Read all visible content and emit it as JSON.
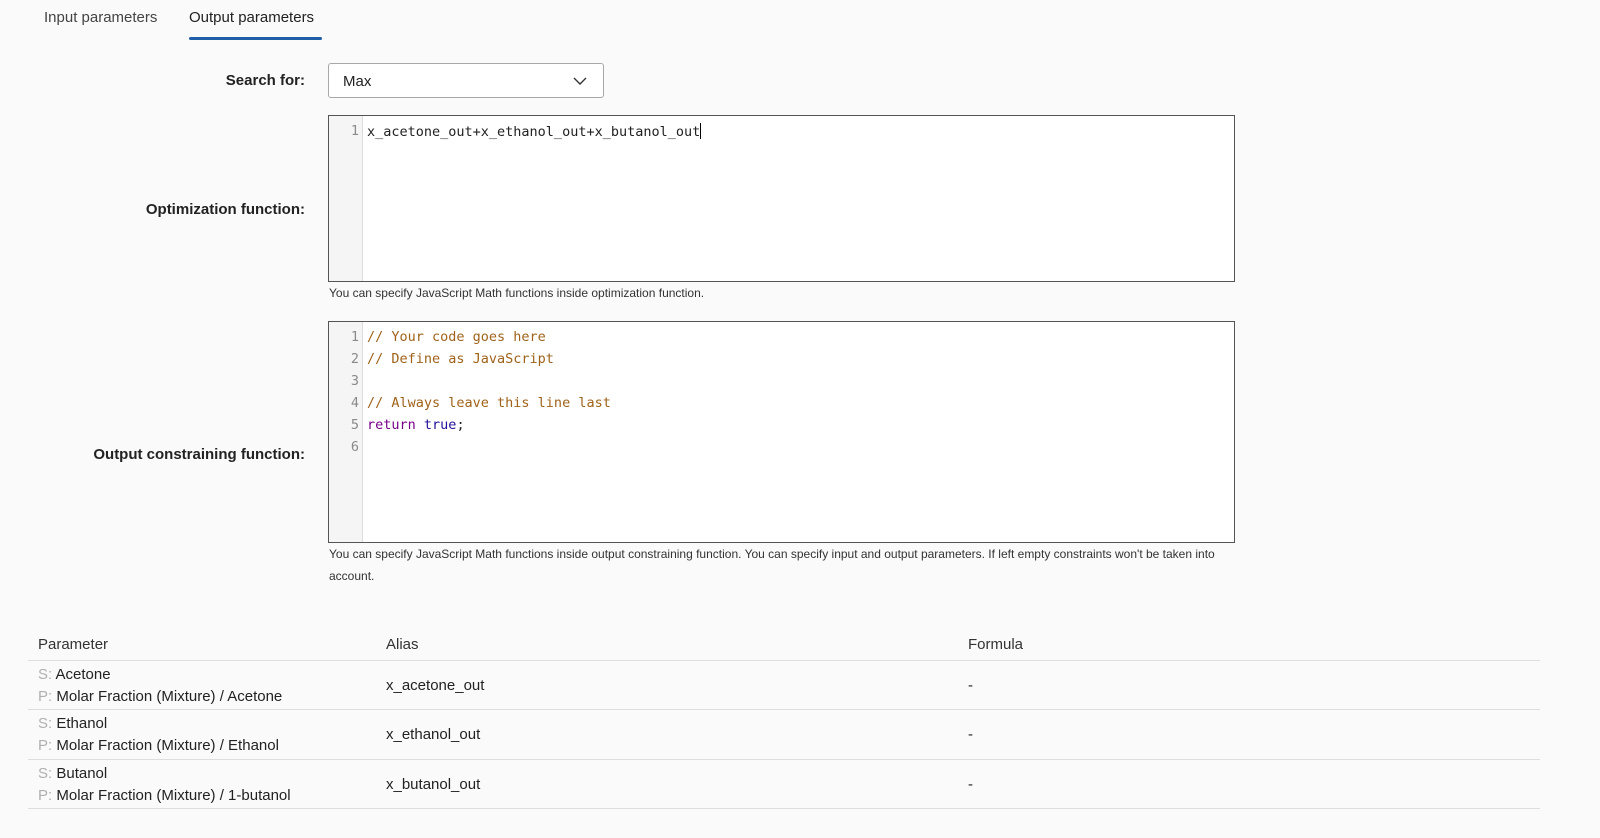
{
  "tabs": [
    {
      "label": "Input parameters",
      "active": false
    },
    {
      "label": "Output parameters",
      "active": true
    }
  ],
  "search": {
    "label": "Search for:",
    "value": "Max"
  },
  "optimization": {
    "label": "Optimization function:",
    "lines": [
      {
        "num": "1",
        "code": "x_acetone_out+x_ethanol_out+x_butanol_out"
      }
    ],
    "help": "You can specify JavaScript Math functions inside optimization function."
  },
  "constraint": {
    "label": "Output constraining function:",
    "lines": [
      {
        "num": "1",
        "code": "// Your code goes here"
      },
      {
        "num": "2",
        "code": "// Define as JavaScript"
      },
      {
        "num": "3",
        "code": ""
      },
      {
        "num": "4",
        "code": "// Always leave this line last"
      },
      {
        "num": "5",
        "keyword": "return",
        "atom": "true",
        "tail": ";"
      },
      {
        "num": "6",
        "code": ""
      }
    ],
    "help": "You can specify JavaScript Math functions inside output constraining function. You can specify input and output parameters. If left empty constraints won't be taken into account."
  },
  "table": {
    "headers": [
      "Parameter",
      "Alias",
      "Formula"
    ],
    "rows": [
      {
        "s_prefix": "S:",
        "stream": "Acetone",
        "p_prefix": "P:",
        "property": "Molar Fraction (Mixture) / Acetone",
        "alias": "x_acetone_out",
        "formula": "-"
      },
      {
        "s_prefix": "S:",
        "stream": "Ethanol",
        "p_prefix": "P:",
        "property": "Molar Fraction (Mixture) / Ethanol",
        "alias": "x_ethanol_out",
        "formula": "-"
      },
      {
        "s_prefix": "S:",
        "stream": "Butanol",
        "p_prefix": "P:",
        "property": "Molar Fraction (Mixture) / 1-butanol",
        "alias": "x_butanol_out",
        "formula": "-"
      }
    ]
  },
  "colors": {
    "accent": "#1e5fa8",
    "comment": "#a0621a",
    "keyword": "#770088",
    "atom": "#221199"
  }
}
